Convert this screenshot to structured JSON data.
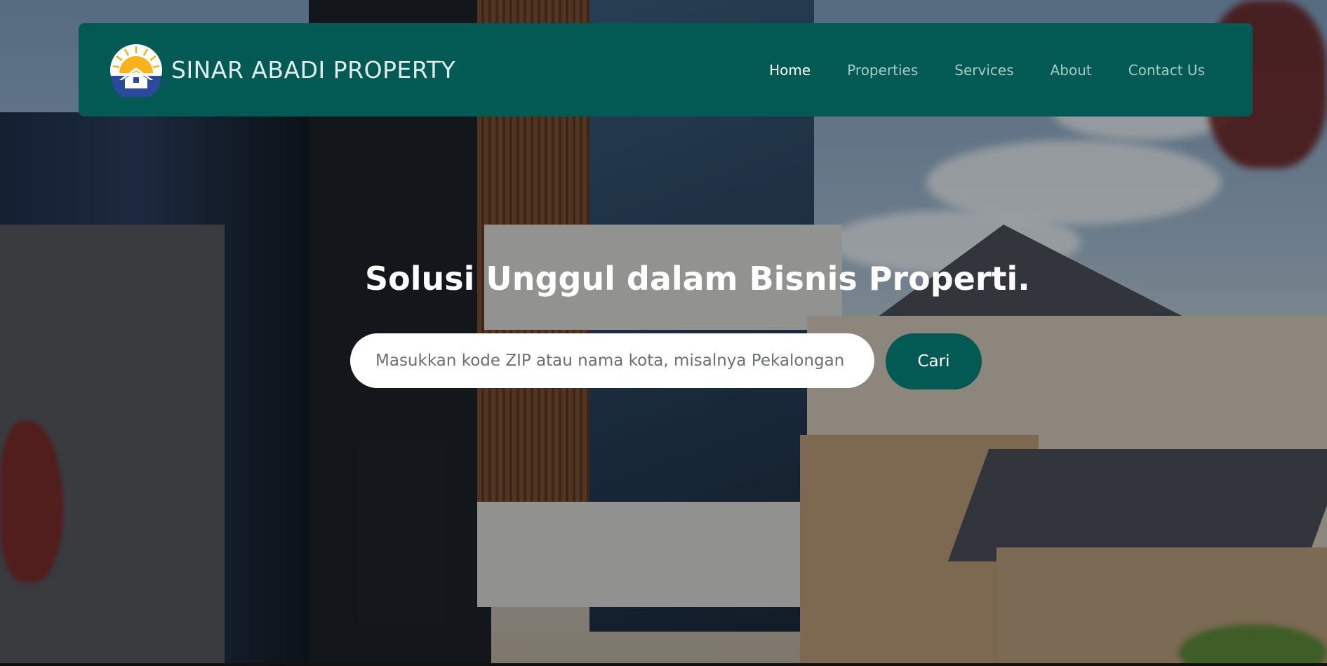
{
  "brand": {
    "name": "SINAR ABADI PROPERTY",
    "logo_icon": "sun-house-logo-icon"
  },
  "nav": {
    "items": [
      {
        "label": "Home",
        "active": true
      },
      {
        "label": "Properties",
        "active": false
      },
      {
        "label": "Services",
        "active": false
      },
      {
        "label": "About",
        "active": false
      },
      {
        "label": "Contact Us",
        "active": false
      }
    ]
  },
  "hero": {
    "title": "Solusi Unggul dalam Bisnis Properti.",
    "background": "modern-houses-photo"
  },
  "search": {
    "placeholder": "Masukkan kode ZIP atau nama kota, misalnya Pekalongan",
    "value": "",
    "button_label": "Cari"
  },
  "colors": {
    "primary": "#035a55",
    "nav_active": "#ffffff",
    "nav_inactive": "#a5cbc7"
  }
}
